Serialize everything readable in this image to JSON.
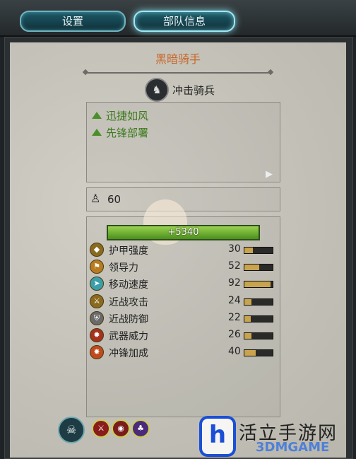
{
  "tabs": {
    "settings_label": "设置",
    "unit_info_label": "部队信息"
  },
  "unit": {
    "name": "黑暗骑手",
    "type": "冲击骑兵",
    "type_icon": "horse-icon"
  },
  "abilities": [
    {
      "label": "迅捷如风",
      "icon": "triangle-up-icon"
    },
    {
      "label": "先锋部署",
      "icon": "triangle-up-icon"
    }
  ],
  "troops": {
    "count": "60",
    "icon": "soldier-icon"
  },
  "health": {
    "value": "+5340"
  },
  "stats": [
    {
      "label": "护甲强度",
      "value": "30",
      "fill": 0.3,
      "icon": "armor-icon",
      "color": "#8a6a1e"
    },
    {
      "label": "领导力",
      "value": "52",
      "fill": 0.52,
      "icon": "leadership-icon",
      "color": "#b97b1f"
    },
    {
      "label": "移动速度",
      "value": "92",
      "fill": 0.92,
      "icon": "speed-icon",
      "color": "#3a9fa8"
    },
    {
      "label": "近战攻击",
      "value": "24",
      "fill": 0.24,
      "icon": "melee-attack-icon",
      "color": "#8a6a1e"
    },
    {
      "label": "近战防御",
      "value": "22",
      "fill": 0.22,
      "icon": "melee-defense-icon",
      "color": "#6a6a6a"
    },
    {
      "label": "武器威力",
      "value": "26",
      "fill": 0.26,
      "icon": "weapon-strength-icon",
      "color": "#a6321e"
    },
    {
      "label": "冲锋加成",
      "value": "40",
      "fill": 0.4,
      "icon": "charge-bonus-icon",
      "color": "#c04a1e"
    }
  ],
  "watermark": {
    "brand": "活立手游网",
    "sub": "3DMGAME"
  },
  "colors": {
    "title": "#c8662a",
    "ability": "#3b7a1b",
    "health": "#7fc23a",
    "accent": "#6fb4c0"
  }
}
